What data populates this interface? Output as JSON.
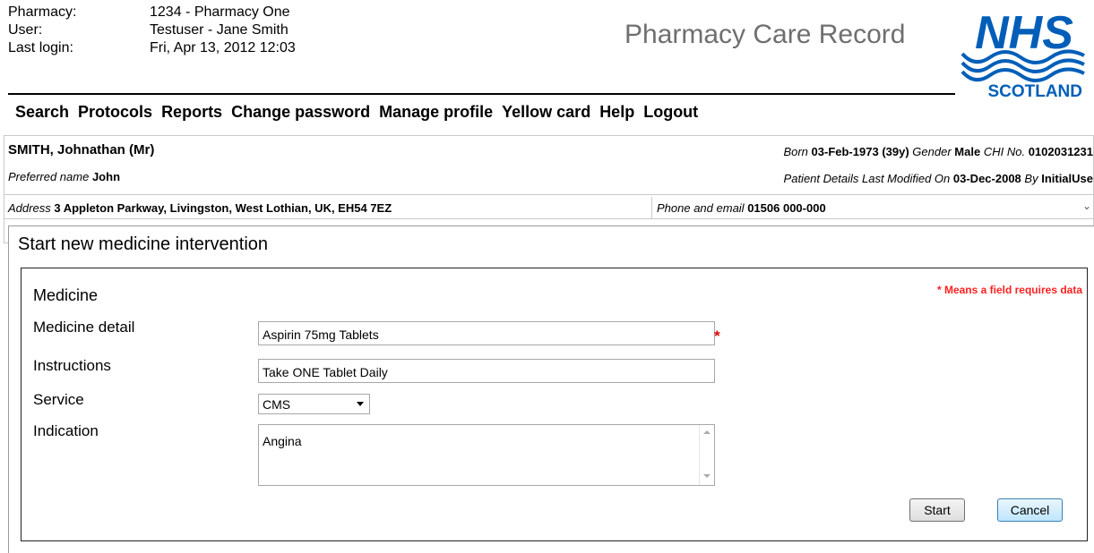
{
  "header": {
    "pharmacy_label": "Pharmacy:",
    "pharmacy_value": "1234 - Pharmacy One",
    "user_label": "User:",
    "user_value": "Testuser - Jane Smith",
    "last_login_label": "Last login:",
    "last_login_value": "Fri, Apr 13, 2012 12:03",
    "app_title": "Pharmacy Care Record",
    "logo_text": "NHS",
    "logo_subtext": "SCOTLAND",
    "logo_color": "#005eb8"
  },
  "menu": {
    "items": [
      "Search",
      "Protocols",
      "Reports",
      "Change password",
      "Manage profile",
      "Yellow card",
      "Help",
      "Logout"
    ]
  },
  "patient": {
    "name": "SMITH, Johnathan (Mr)",
    "born_label": "Born",
    "born_value": "03-Feb-1973",
    "age": "(39y)",
    "gender_label": "Gender",
    "gender_value": "Male",
    "chi_label": "CHI No.",
    "chi_value": "0102031231",
    "preferred_label": "Preferred name",
    "preferred_value": "John",
    "modified_label": "Patient Details Last Modified On",
    "modified_date": "03-Dec-2008",
    "modified_by_label": "By",
    "modified_by": "InitialUse",
    "address_label": "Address",
    "address_value": "3 Appleton Parkway, Livingston, West Lothian, UK, EH54 7EZ",
    "phone_label": "Phone and email",
    "phone_value": "01506 000-000"
  },
  "form": {
    "panel_title": "Start new medicine intervention",
    "section_title": "Medicine",
    "required_note": "* Means a field requires data",
    "medicine_detail_label": "Medicine detail",
    "medicine_detail_value": "Aspirin 75mg Tablets",
    "required_star": "*",
    "instructions_label": "Instructions",
    "instructions_value": "Take ONE Tablet Daily",
    "service_label": "Service",
    "service_value": "CMS",
    "indication_label": "Indication",
    "indication_value": "Angina",
    "start_label": "Start",
    "cancel_label": "Cancel"
  }
}
